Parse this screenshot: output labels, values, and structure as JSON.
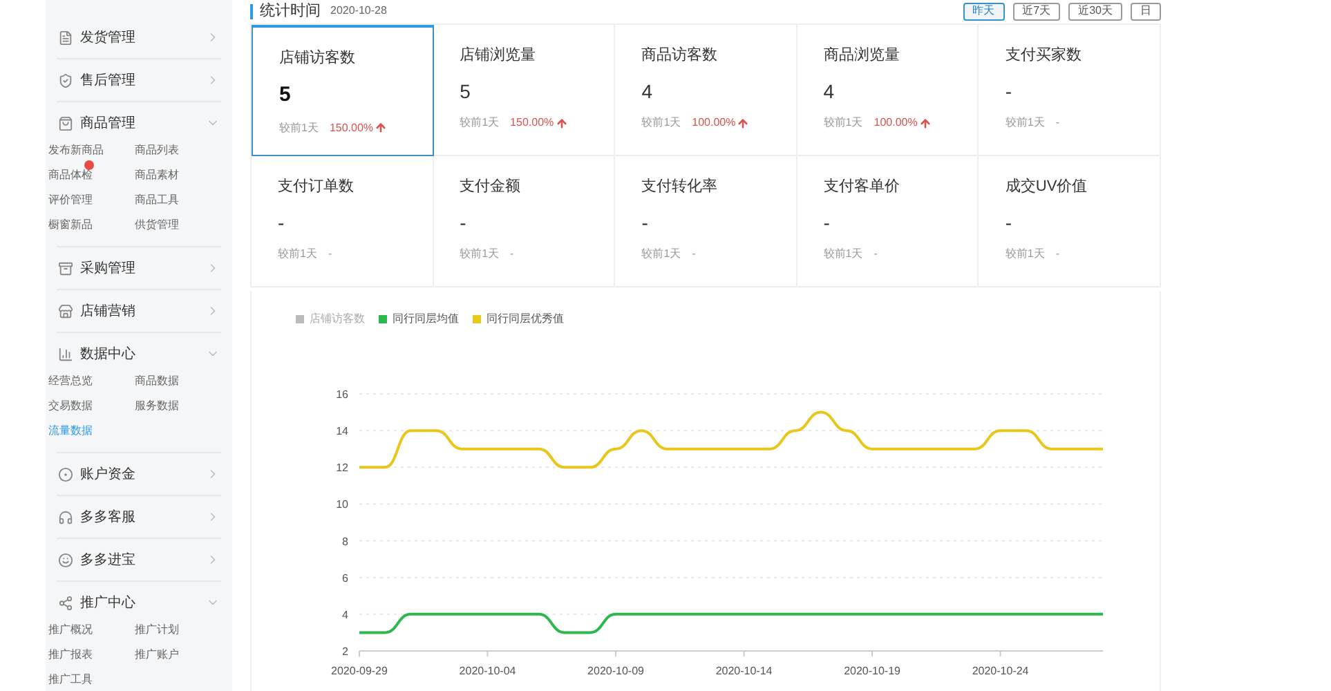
{
  "sidebar": {
    "groups": [
      {
        "label": "发货管理",
        "expanded": false
      },
      {
        "label": "售后管理",
        "expanded": false
      },
      {
        "label": "商品管理",
        "expanded": true,
        "children": [
          {
            "label": "发布新商品",
            "selected": false,
            "badge": false
          },
          {
            "label": "商品列表",
            "selected": false,
            "badge": false
          },
          {
            "label": "商品体检",
            "selected": false,
            "badge": true
          },
          {
            "label": "商品素材",
            "selected": false,
            "badge": false
          },
          {
            "label": "评价管理",
            "selected": false,
            "badge": false
          },
          {
            "label": "商品工具",
            "selected": false,
            "badge": false
          },
          {
            "label": "橱窗新品",
            "selected": false,
            "badge": false
          },
          {
            "label": "供货管理",
            "selected": false,
            "badge": false
          }
        ]
      },
      {
        "label": "采购管理",
        "expanded": false
      },
      {
        "label": "店铺营销",
        "expanded": false
      },
      {
        "label": "数据中心",
        "expanded": true,
        "children": [
          {
            "label": "经营总览",
            "selected": false,
            "badge": false
          },
          {
            "label": "商品数据",
            "selected": false,
            "badge": false
          },
          {
            "label": "交易数据",
            "selected": false,
            "badge": false
          },
          {
            "label": "服务数据",
            "selected": false,
            "badge": false
          },
          {
            "label": "流量数据",
            "selected": true,
            "badge": false
          }
        ]
      },
      {
        "label": "账户资金",
        "expanded": false
      },
      {
        "label": "多多客服",
        "expanded": false
      },
      {
        "label": "多多进宝",
        "expanded": false
      },
      {
        "label": "推广中心",
        "expanded": true,
        "children": [
          {
            "label": "推广概况",
            "selected": false,
            "badge": false
          },
          {
            "label": "推广计划",
            "selected": false,
            "badge": false
          },
          {
            "label": "推广报表",
            "selected": false,
            "badge": false
          },
          {
            "label": "推广账户",
            "selected": false,
            "badge": false
          },
          {
            "label": "推广工具",
            "selected": false,
            "badge": false
          }
        ]
      }
    ]
  },
  "header": {
    "title": "统计时间",
    "date": "2020-10-28"
  },
  "ranges": [
    {
      "label": "昨天",
      "selected": true
    },
    {
      "label": "近7天",
      "selected": false
    },
    {
      "label": "近30天",
      "selected": false
    },
    {
      "label": "日",
      "selected": false
    }
  ],
  "stats": [
    {
      "label": "店铺访客数",
      "value": "5",
      "compare": "较前1天",
      "change": "150.00%",
      "rising": true,
      "selected": true
    },
    {
      "label": "店铺浏览量",
      "value": "5",
      "compare": "较前1天",
      "change": "150.00%",
      "rising": true,
      "selected": false
    },
    {
      "label": "商品访客数",
      "value": "4",
      "compare": "较前1天",
      "change": "100.00%",
      "rising": true,
      "selected": false
    },
    {
      "label": "商品浏览量",
      "value": "4",
      "compare": "较前1天",
      "change": "100.00%",
      "rising": true,
      "selected": false
    },
    {
      "label": "支付买家数",
      "value": "-",
      "compare": "较前1天",
      "change": "-",
      "rising": false,
      "selected": false
    },
    {
      "label": "支付订单数",
      "value": "-",
      "compare": "较前1天",
      "change": "-",
      "rising": false,
      "selected": false
    },
    {
      "label": "支付金额",
      "value": "-",
      "compare": "较前1天",
      "change": "-",
      "rising": false,
      "selected": false
    },
    {
      "label": "支付转化率",
      "value": "-",
      "compare": "较前1天",
      "change": "-",
      "rising": false,
      "selected": false
    },
    {
      "label": "支付客单价",
      "value": "-",
      "compare": "较前1天",
      "change": "-",
      "rising": false,
      "selected": false
    },
    {
      "label": "成交UV价值",
      "value": "-",
      "compare": "较前1天",
      "change": "-",
      "rising": false,
      "selected": false
    }
  ],
  "chart_data": {
    "type": "line",
    "grid": true,
    "categories": [
      "2020-09-29",
      null,
      null,
      null,
      null,
      "2020-10-04",
      null,
      null,
      null,
      null,
      "2020-10-09",
      null,
      null,
      null,
      null,
      "2020-10-14",
      null,
      null,
      null,
      null,
      "2020-10-19",
      null,
      null,
      null,
      null,
      "2020-10-24",
      null,
      null,
      null,
      null
    ],
    "series": [
      {
        "name": "店铺访客数",
        "color": "#bbbbbb",
        "values": [
          null,
          null,
          null,
          null,
          null,
          null,
          null,
          null,
          null,
          null,
          null,
          null,
          null,
          null,
          null,
          null,
          null,
          null,
          null,
          null,
          null,
          null,
          null,
          null,
          null,
          null,
          null,
          null,
          null,
          null
        ]
      },
      {
        "name": "同行同层均值",
        "color": "#2db84d",
        "values": [
          3,
          3,
          4,
          4,
          4,
          4,
          4,
          4,
          3,
          3,
          4,
          4,
          4,
          4,
          4,
          4,
          4,
          4,
          4,
          4,
          4,
          4,
          4,
          4,
          4,
          4,
          4,
          4,
          4,
          4
        ]
      },
      {
        "name": "同行同层优秀值",
        "color": "#e8c61c",
        "values": [
          12,
          12,
          14,
          14,
          13,
          13,
          13,
          13,
          12,
          12,
          13,
          14,
          13,
          13,
          13,
          13,
          13,
          14,
          15,
          14,
          13,
          13,
          13,
          13,
          13,
          14,
          14,
          13,
          13,
          13
        ]
      }
    ],
    "ylim": [
      2,
      16
    ],
    "yticks": [
      2,
      4,
      6,
      8,
      10,
      12,
      14,
      16
    ]
  }
}
